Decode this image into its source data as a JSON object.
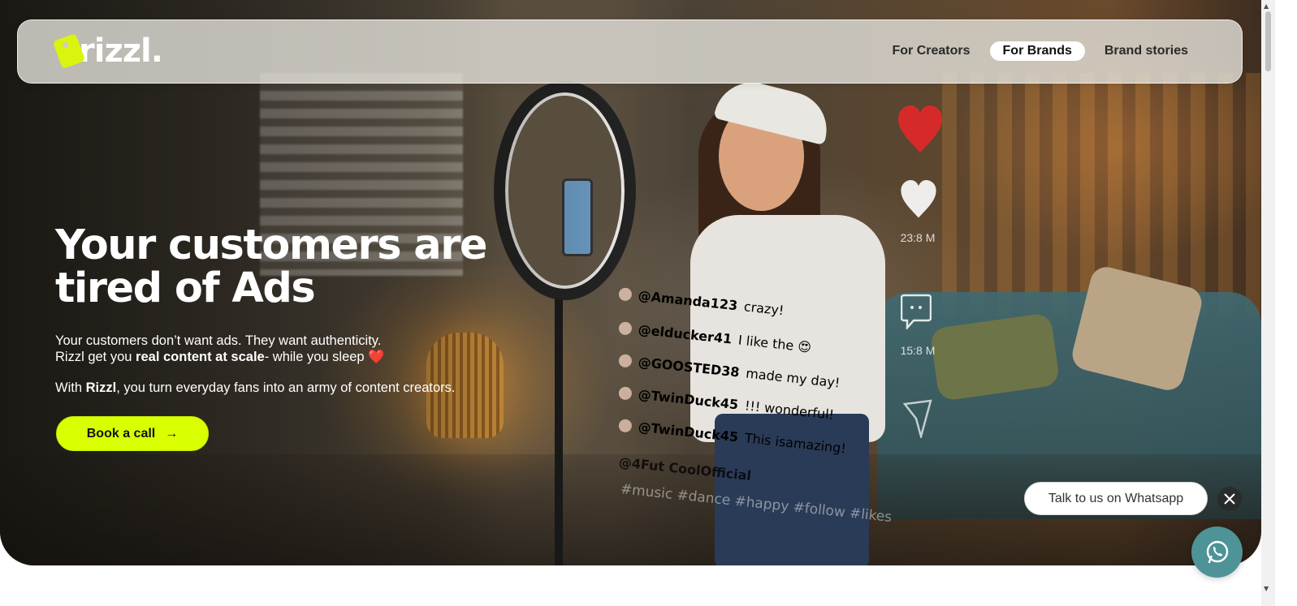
{
  "nav": {
    "logo_text": "rizzl.",
    "links": [
      {
        "label": "For Creators"
      },
      {
        "label": "For Brands"
      },
      {
        "label": "Brand stories"
      }
    ],
    "active_index": 1
  },
  "hero": {
    "headline_line1": "Your customers are",
    "headline_line2": "tired of Ads",
    "sub_line1": "Your customers don’t want ads. They want authenticity.",
    "sub_line2_prefix": "Rizzl get you ",
    "sub_line2_bold": "real content at scale",
    "sub_line2_suffix": "- while you sleep ",
    "sub_line2_emoji": "❤️",
    "sub3_prefix": "With ",
    "sub3_bold": "Rizzl",
    "sub3_suffix": ", you turn everyday fans into an army of content creators.",
    "cta_label": "Book a call",
    "cta_arrow": "→"
  },
  "social_overlay": {
    "like_count": "23:8 M",
    "comment_count": "15:8 M",
    "comments": [
      {
        "handle": "@Amanda123",
        "text": "crazy!"
      },
      {
        "handle": "@elducker41",
        "text": "I like the 😍"
      },
      {
        "handle": "@GOOSTED38",
        "text": "made my day!"
      },
      {
        "handle": "@TwinDuck45",
        "text": "!!! wonderful!"
      },
      {
        "handle": "@TwinDuck45",
        "text": "This isamazing!"
      },
      {
        "handle": "@4Fut CoolOfficial",
        "text": ""
      }
    ],
    "hashtags": "#music #dance #happy #follow #likes"
  },
  "whatsapp": {
    "bubble_text": "Talk to us on Whatsapp",
    "close_icon": "close-icon",
    "button_icon": "whatsapp-icon",
    "color": "#4e9398"
  },
  "colors": {
    "accent": "#d9ff00",
    "heart_red": "#d62a2a"
  }
}
